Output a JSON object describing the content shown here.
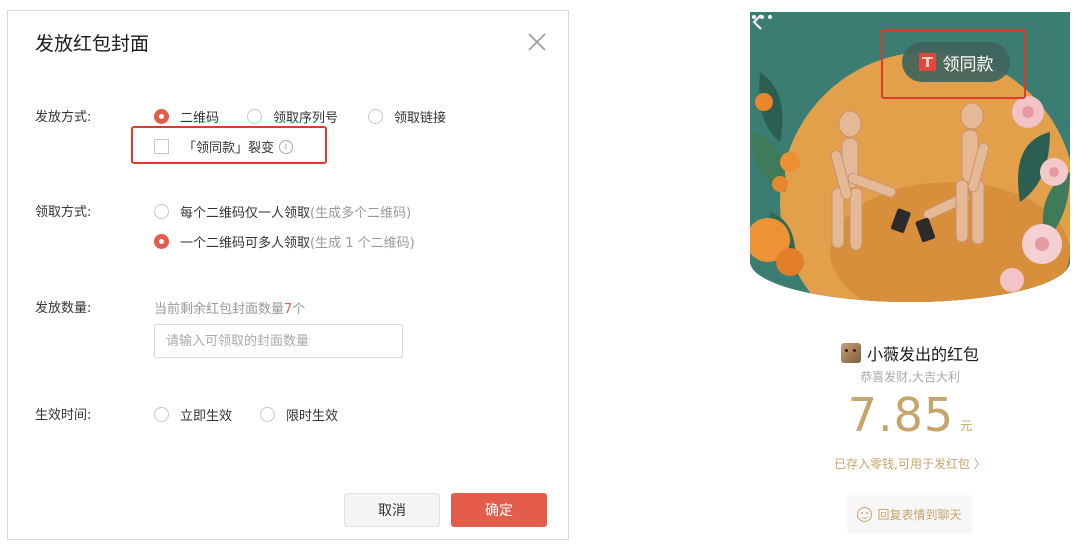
{
  "dialog": {
    "title": "发放红包封面",
    "issue_method": {
      "label": "发放方式:",
      "options": [
        "二维码",
        "领取序列号",
        "领取链接"
      ],
      "selected": "二维码",
      "fission_checkbox": {
        "label": "「领同款」裂变",
        "checked": false
      }
    },
    "claim_method": {
      "label": "领取方式:",
      "options": [
        {
          "text": "每个二维码仅一人领取",
          "hint": "(生成多个二维码)",
          "checked": false
        },
        {
          "text": "一个二维码可多人领取",
          "hint": "(生成 1 个二维码)",
          "checked": true
        }
      ]
    },
    "quantity": {
      "label": "发放数量:",
      "remain_prefix": "当前剩余红包封面数量",
      "remain_count": "7",
      "remain_suffix": "个",
      "placeholder": "请输入可领取的封面数量",
      "value": ""
    },
    "effective_time": {
      "label": "生效时间:",
      "options": [
        "立即生效",
        "限时生效"
      ],
      "selected": null
    },
    "buttons": {
      "cancel": "取消",
      "confirm": "确定"
    }
  },
  "phone": {
    "same_style_button": "领同款",
    "sender": "小薇发出的红包",
    "wish": "恭喜发财,大吉大利",
    "amount": "7.85",
    "currency": "元",
    "saved_note": "已存入零钱,可用于发红包 〉",
    "reply_button": "回复表情到聊天"
  },
  "colors": {
    "accent": "#e45d4b",
    "highlight_box": "#e03a2c",
    "gold": "#c6a56a",
    "hero_teal": "#3b7d73",
    "hero_orange": "#e3a04a"
  },
  "icons": [
    "close-icon",
    "info-icon",
    "back-icon",
    "more-icon",
    "envelope-icon",
    "smile-icon"
  ]
}
